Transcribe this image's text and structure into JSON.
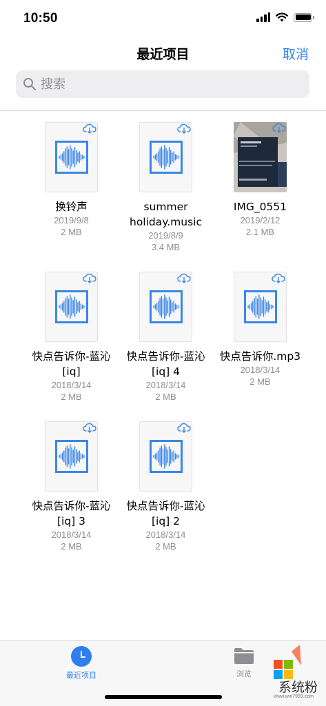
{
  "status_bar": {
    "time": "10:50"
  },
  "nav": {
    "title": "最近项目",
    "cancel_label": "取消"
  },
  "search": {
    "placeholder": "搜索"
  },
  "files": [
    {
      "name": "换铃声",
      "date": "2019/9/8",
      "size": "2 MB",
      "type": "audio"
    },
    {
      "name": "summer holiday.music",
      "date": "2019/8/9",
      "size": "3.4 MB",
      "type": "audio"
    },
    {
      "name": "IMG_0551",
      "date": "2019/2/12",
      "size": "2.1 MB",
      "type": "image"
    },
    {
      "name": "快点告诉你-蓝沁[iq]",
      "date": "2018/3/14",
      "size": "2 MB",
      "type": "audio"
    },
    {
      "name": "快点告诉你-蓝沁[iq] 4",
      "date": "2018/3/14",
      "size": "2 MB",
      "type": "audio"
    },
    {
      "name": "快点告诉你.mp3",
      "date": "2018/3/14",
      "size": "2 MB",
      "type": "audio"
    },
    {
      "name": "快点告诉你-蓝沁[iq] 3",
      "date": "2018/3/14",
      "size": "2 MB",
      "type": "audio"
    },
    {
      "name": "快点告诉你-蓝沁[iq] 2",
      "date": "2018/3/14",
      "size": "2 MB",
      "type": "audio"
    }
  ],
  "tabs": {
    "recents_label": "最近项目",
    "browse_label": "浏览"
  },
  "colors": {
    "accent": "#2f7ef0",
    "audio_icon": "#3a86e8",
    "secondary_text": "#8e8e93"
  },
  "watermark": {
    "text": "系统粉",
    "url": "www.win7999.com"
  }
}
